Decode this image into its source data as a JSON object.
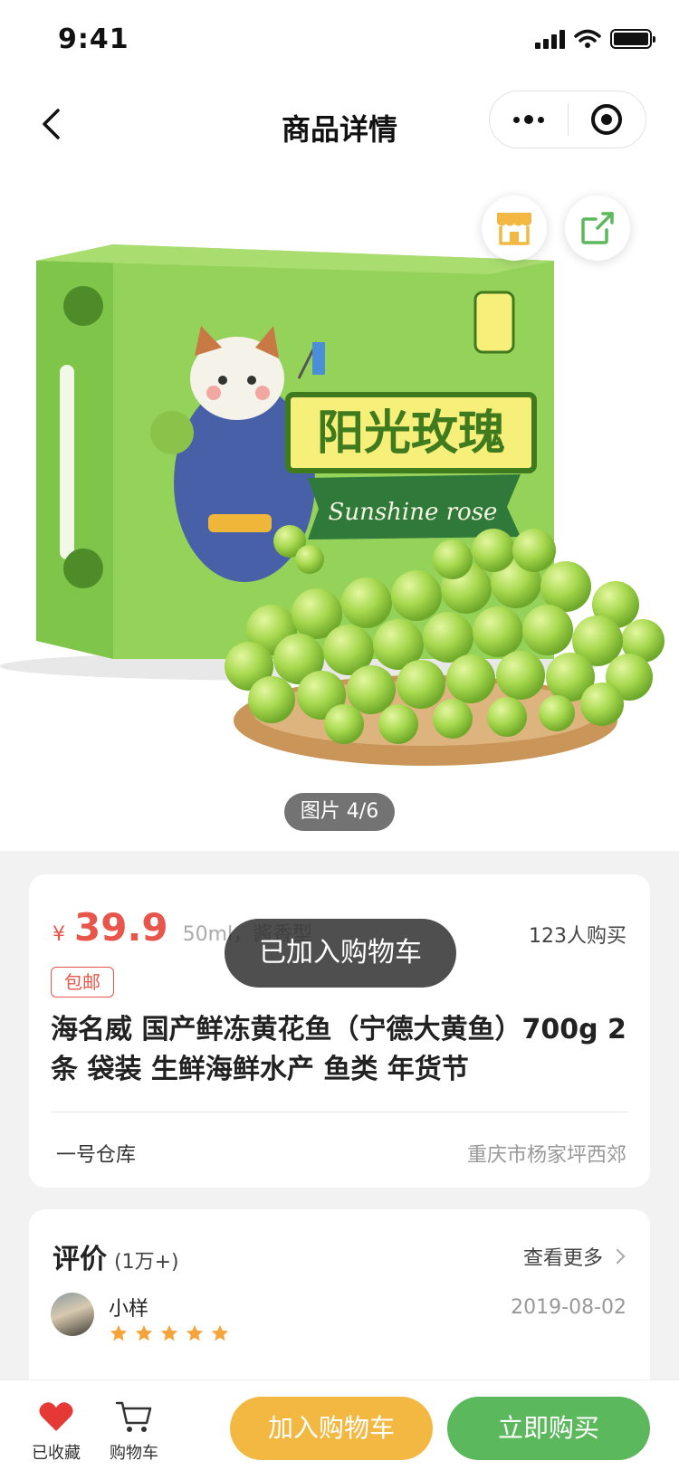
{
  "status_bar": {
    "time": "9:41"
  },
  "nav": {
    "title": "商品详情"
  },
  "hero": {
    "image_counter": "图片 4/6",
    "box_title": "阳光玫瑰",
    "box_subtitle": "Sunshine rose"
  },
  "product": {
    "currency": "¥",
    "price": "39.9",
    "spec": "50ml，酱香型",
    "sold": "123人购买",
    "shipping_tag": "包邮",
    "title": "海名威 国产鲜冻黄花鱼（宁德大黄鱼）700g 2条 袋装 生鲜海鲜水产 鱼类 年货节",
    "warehouse": "一号仓库",
    "location": "重庆市杨家坪西郊"
  },
  "toast": {
    "message": "已加入购物车"
  },
  "reviews": {
    "title": "评价",
    "count": "(1万+)",
    "see_more": "查看更多",
    "items": [
      {
        "name": "小样",
        "date": "2019-08-02",
        "rating": 5
      }
    ]
  },
  "tab_bar": {
    "favorite_label": "已收藏",
    "cart_label": "购物车",
    "add_to_cart": "加入购物车",
    "buy_now": "立即购买"
  },
  "colors": {
    "price_red": "#e8554a",
    "cart_yellow": "#f2b841",
    "buy_green": "#5cb85c",
    "grape_green": "#9ad148",
    "star_orange": "#f5a43b"
  }
}
